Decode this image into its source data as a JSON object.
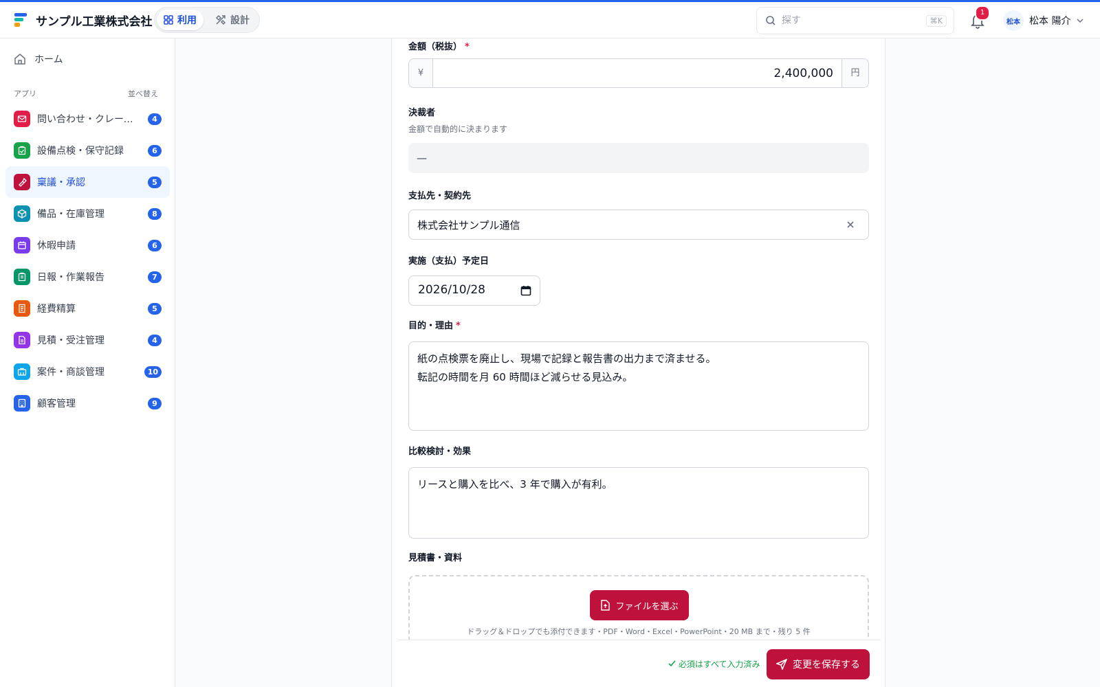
{
  "header": {
    "company": "サンプル工業株式会社",
    "modes": [
      {
        "label": "利用",
        "active": true
      },
      {
        "label": "設計",
        "active": false
      }
    ],
    "search_placeholder": "探す",
    "search_shortcut": "⌘K",
    "notification_count": "1",
    "user_avatar": "松本",
    "user_name": "松本 陽介"
  },
  "sidebar": {
    "home": "ホーム",
    "apps_label": "アプリ",
    "sort_label": "並べ替え",
    "items": [
      {
        "label": "問い合わせ・クレーム管理",
        "count": "4",
        "icon": "mail-icon",
        "color": "#e11d48"
      },
      {
        "label": "設備点検・保守記録",
        "count": "6",
        "icon": "clipboard-check-icon",
        "color": "#16a34a"
      },
      {
        "label": "稟議・承認",
        "count": "5",
        "icon": "stamp-icon",
        "color": "#be123c",
        "active": true
      },
      {
        "label": "備品・在庫管理",
        "count": "8",
        "icon": "box-icon",
        "color": "#0891b2"
      },
      {
        "label": "休暇申請",
        "count": "6",
        "icon": "calendar-icon",
        "color": "#7c3aed"
      },
      {
        "label": "日報・作業報告",
        "count": "7",
        "icon": "clipboard-icon",
        "color": "#059669"
      },
      {
        "label": "経費精算",
        "count": "5",
        "icon": "receipt-icon",
        "color": "#ea580c"
      },
      {
        "label": "見積・受注管理",
        "count": "4",
        "icon": "document-icon",
        "color": "#9333ea"
      },
      {
        "label": "案件・商談管理",
        "count": "10",
        "icon": "briefcase-icon",
        "color": "#0ea5e9"
      },
      {
        "label": "顧客管理",
        "count": "9",
        "icon": "building-icon",
        "color": "#2563eb"
      }
    ]
  },
  "form": {
    "amount_label": "金額（税抜）",
    "amount_prefix": "¥",
    "amount_value": "2,400,000",
    "amount_suffix": "円",
    "approver_label": "決裁者",
    "approver_hint": "金額で自動的に決まります",
    "approver_value": "—",
    "payee_label": "支払先・契約先",
    "payee_value": "株式会社サンプル通信",
    "date_label": "実施（支払）予定日",
    "date_value": "2026/10/28",
    "purpose_label": "目的・理由",
    "purpose_line1": "紙の点検票を廃止し、現場で記録と報告書の出力まで済ませる。",
    "purpose_line2": "転記の時間を月 60 時間ほど減らせる見込み。",
    "compare_label": "比較検討・効果",
    "compare_value": "リースと購入を比べ、3 年で購入が有利。",
    "attach_label": "見積書・資料",
    "file_button": "ファイルを選ぶ",
    "drop_note": "ドラッグ＆ドロップでも添付できます・PDF・Word・Excel・PowerPoint・20 MB まで・残り 5 件",
    "required_mark": "*"
  },
  "footer": {
    "status": "必須はすべて入力済み",
    "save_label": "変更を保存する"
  },
  "colors": {
    "accent": "#2563eb",
    "primary_button": "#be123c",
    "success": "#16a34a"
  }
}
